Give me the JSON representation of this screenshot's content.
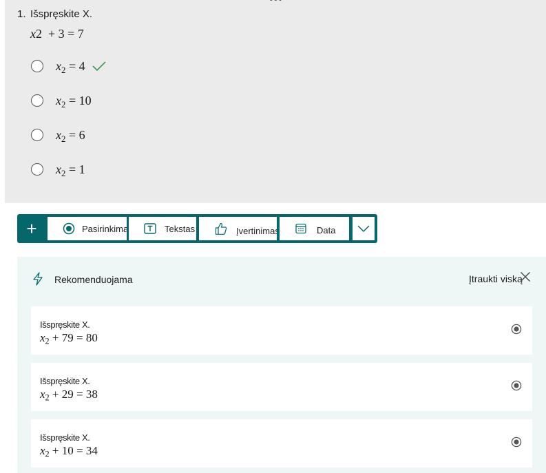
{
  "question": {
    "number": "1.",
    "title": "Išspręskite X.",
    "equation": {
      "lhs_var": "x",
      "lhs_rest": "2  + 3 = 7"
    },
    "options": [
      {
        "var": "x",
        "sub": "2",
        "rest": " = 4",
        "correct": true
      },
      {
        "var": "x",
        "sub": "2",
        "rest": " = 10",
        "correct": false
      },
      {
        "var": "x",
        "sub": "2",
        "rest": " = 6",
        "correct": false
      },
      {
        "var": "x",
        "sub": "2",
        "rest": " = 1",
        "correct": false
      }
    ]
  },
  "toolbar": {
    "add_label": "+",
    "items": [
      {
        "label": "Pasirinkimas",
        "icon": "radio-choice-icon"
      },
      {
        "label": "Tekstas",
        "icon": "text-icon"
      },
      {
        "label": "Įvertinimas",
        "icon": "thumbs-up-icon"
      },
      {
        "label": "Data",
        "icon": "calendar-icon"
      }
    ],
    "more_icon": "chevron-down-icon"
  },
  "recommendations": {
    "title": "Rekomenduojama",
    "add_all_label": "Įtraukti viską",
    "items": [
      {
        "label": "Išspręskite X.",
        "var": "x",
        "sub": "2",
        "rest": " + 79 = 80"
      },
      {
        "label": "Išspręskite X.",
        "var": "x",
        "sub": "2",
        "rest": " + 29 = 38"
      },
      {
        "label": "Išspręskite X.",
        "var": "x",
        "sub": "2",
        "rest": " + 10 = 34"
      }
    ]
  },
  "colors": {
    "accent": "#05676b",
    "card_bg": "#ebebeb",
    "panel_bg": "#eef6f6",
    "check": "#3a9a55"
  }
}
